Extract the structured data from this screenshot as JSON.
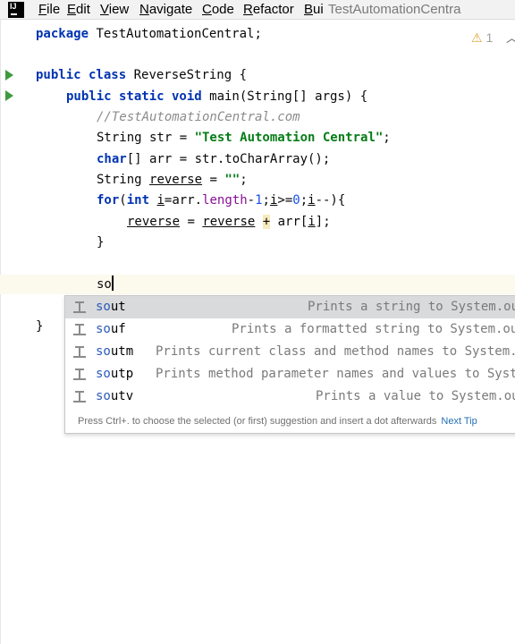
{
  "menubar": {
    "app_icon_text": "IJ",
    "menus": [
      {
        "underline": "F",
        "rest": "ile"
      },
      {
        "underline": "E",
        "rest": "dit"
      },
      {
        "underline": "V",
        "rest": "iew"
      },
      {
        "underline": "N",
        "rest": "avigate"
      },
      {
        "underline": "C",
        "rest": "ode"
      },
      {
        "underline": "R",
        "rest": "efactor"
      },
      {
        "underline": "B",
        "rest": "ui"
      }
    ],
    "window_title": "TestAutomationCentra"
  },
  "editor": {
    "warning_count": "1",
    "lines": {
      "l1_kw": "package",
      "l1_rest": " TestAutomationCentral;",
      "l3_kw": "public class",
      "l3_rest": " ReverseString {",
      "l4_kw": "public static void",
      "l4_rest": " main(String[] args) {",
      "l5_comment": "//TestAutomationCentral.com",
      "l6_pre": "String str = ",
      "l6_str": "\"Test Automation Central\"",
      "l6_post": ";",
      "l7_kw": "char",
      "l7_rest": "[] arr = str.toCharArray();",
      "l8_pre": "String ",
      "l8_var": "reverse",
      "l8_mid": " = ",
      "l8_str": "\"\"",
      "l8_post": ";",
      "l9_kw1": "for",
      "l9_a": "(",
      "l9_kw2": "int",
      "l9_b": " ",
      "l9_i1": "i",
      "l9_c": "=arr.",
      "l9_field": "length",
      "l9_d": "-",
      "l9_num1": "1",
      "l9_e": ";",
      "l9_i2": "i",
      "l9_f": ">=",
      "l9_num2": "0",
      "l9_g": ";",
      "l9_i3": "i",
      "l9_h": "--){",
      "l10_v1": "reverse",
      "l10_a": " = ",
      "l10_v2": "reverse",
      "l10_b": " ",
      "l10_plus": "+",
      "l10_c": " arr[",
      "l10_i": "i",
      "l10_d": "];",
      "l11": "}",
      "l13_typed": "so",
      "l15": "}"
    }
  },
  "completion": {
    "items": [
      {
        "match": "so",
        "rest": "ut",
        "desc": "Prints a string to System.out"
      },
      {
        "match": "so",
        "rest": "uf",
        "desc": "Prints a formatted string to System.out"
      },
      {
        "match": "so",
        "rest": "utm",
        "desc": "Prints current class and method names to System.out"
      },
      {
        "match": "so",
        "rest": "utp",
        "desc": "Prints method parameter names and values to System.out"
      },
      {
        "match": "so",
        "rest": "utv",
        "desc": "Prints a value to System.out"
      }
    ],
    "hint_text": "Press Ctrl+. to choose the selected (or first) suggestion and insert a dot afterwards",
    "hint_link": "Next Tip"
  }
}
